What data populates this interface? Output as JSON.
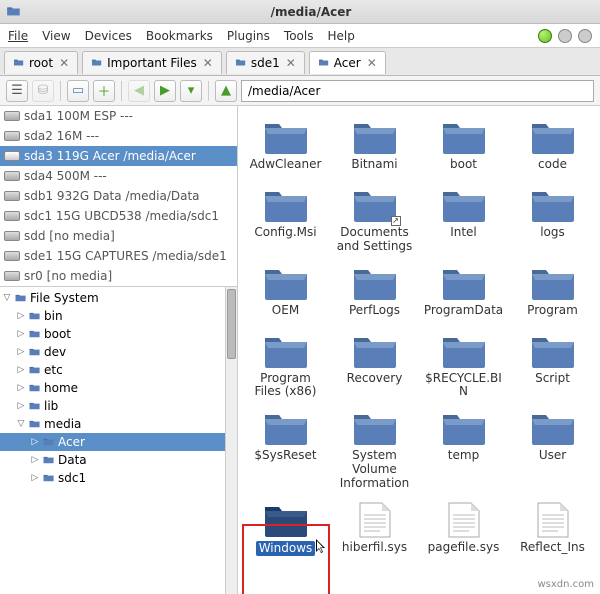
{
  "window": {
    "title": "/media/Acer"
  },
  "menu": [
    "File",
    "View",
    "Devices",
    "Bookmarks",
    "Plugins",
    "Tools",
    "Help"
  ],
  "tabs": [
    {
      "label": "root",
      "active": false
    },
    {
      "label": "Important Files",
      "active": false
    },
    {
      "label": "sde1",
      "active": false
    },
    {
      "label": "Acer",
      "active": true
    }
  ],
  "path": "/media/Acer",
  "drives": [
    {
      "label": "sda1 100M ESP ---",
      "sel": false
    },
    {
      "label": "sda2 16M ---",
      "sel": false
    },
    {
      "label": "sda3 119G Acer /media/Acer",
      "sel": true
    },
    {
      "label": "sda4 500M ---",
      "sel": false
    },
    {
      "label": "sdb1 932G Data /media/Data",
      "sel": false
    },
    {
      "label": "sdc1 15G UBCD538 /media/sdc1",
      "sel": false
    },
    {
      "label": "sdd [no media]",
      "sel": false
    },
    {
      "label": "sde1 15G CAPTURES /media/sde1",
      "sel": false
    },
    {
      "label": "sr0 [no media]",
      "sel": false
    }
  ],
  "tree": [
    {
      "label": "File System",
      "indent": 0,
      "caret": "down"
    },
    {
      "label": "bin",
      "indent": 1,
      "caret": "right"
    },
    {
      "label": "boot",
      "indent": 1,
      "caret": "right"
    },
    {
      "label": "dev",
      "indent": 1,
      "caret": "right"
    },
    {
      "label": "etc",
      "indent": 1,
      "caret": "right"
    },
    {
      "label": "home",
      "indent": 1,
      "caret": "right"
    },
    {
      "label": "lib",
      "indent": 1,
      "caret": "right"
    },
    {
      "label": "media",
      "indent": 1,
      "caret": "down"
    },
    {
      "label": "Acer",
      "indent": 2,
      "caret": "right",
      "sel": true
    },
    {
      "label": "Data",
      "indent": 2,
      "caret": "right"
    },
    {
      "label": "sdc1",
      "indent": 2,
      "caret": "right"
    }
  ],
  "items": [
    {
      "label": "AdwCleaner",
      "type": "folder"
    },
    {
      "label": "Bitnami",
      "type": "folder"
    },
    {
      "label": "boot",
      "type": "folder"
    },
    {
      "label": "code",
      "type": "folder"
    },
    {
      "label": "Config.Msi",
      "type": "folder"
    },
    {
      "label": "Documents and Settings",
      "type": "folder",
      "link": true
    },
    {
      "label": "Intel",
      "type": "folder"
    },
    {
      "label": "logs",
      "type": "folder"
    },
    {
      "label": "OEM",
      "type": "folder"
    },
    {
      "label": "PerfLogs",
      "type": "folder"
    },
    {
      "label": "ProgramData",
      "type": "folder"
    },
    {
      "label": "Program",
      "type": "folder"
    },
    {
      "label": "Program Files (x86)",
      "type": "folder"
    },
    {
      "label": "Recovery",
      "type": "folder"
    },
    {
      "label": "$RECYCLE.BIN",
      "type": "folder"
    },
    {
      "label": "Script",
      "type": "folder"
    },
    {
      "label": "$SysReset",
      "type": "folder"
    },
    {
      "label": "System Volume Information",
      "type": "folder"
    },
    {
      "label": "temp",
      "type": "folder"
    },
    {
      "label": "User",
      "type": "folder"
    },
    {
      "label": "Windows",
      "type": "folder",
      "sel": true,
      "cursor": true
    },
    {
      "label": "hiberfil.sys",
      "type": "file"
    },
    {
      "label": "pagefile.sys",
      "type": "file"
    },
    {
      "label": "Reflect_Ins",
      "type": "file"
    }
  ],
  "watermark": "wsxdn.com"
}
